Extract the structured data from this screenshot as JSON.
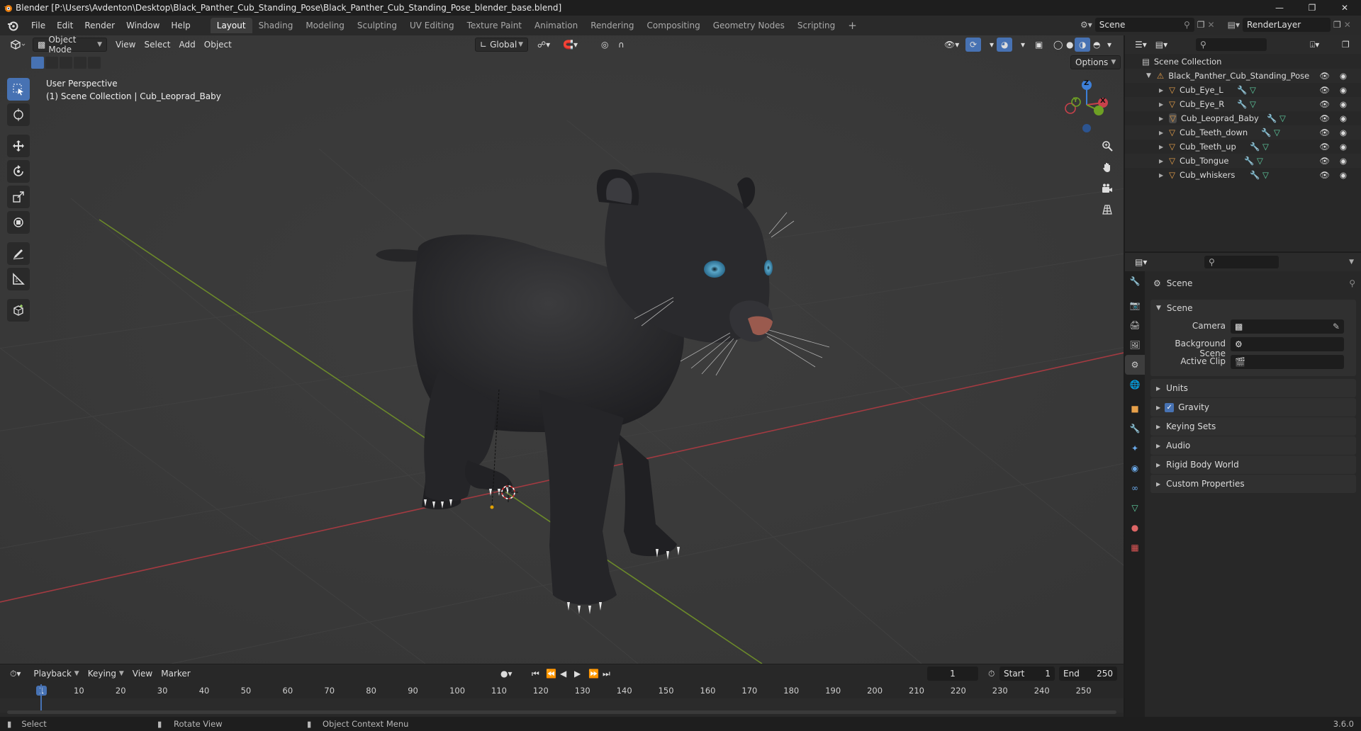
{
  "window": {
    "title": "Blender [P:\\Users\\Avdenton\\Desktop\\Black_Panther_Cub_Standing_Pose\\Black_Panther_Cub_Standing_Pose_blender_base.blend]",
    "controls": [
      "minimize-icon",
      "maximize-icon",
      "close-icon"
    ]
  },
  "menu": {
    "items": [
      "File",
      "Edit",
      "Render",
      "Window",
      "Help"
    ]
  },
  "workspaces": {
    "tabs": [
      "Layout",
      "Shading",
      "Modeling",
      "Sculpting",
      "UV Editing",
      "Texture Paint",
      "Animation",
      "Rendering",
      "Compositing",
      "Geometry Nodes",
      "Scripting"
    ],
    "active": "Layout",
    "add_label": "+"
  },
  "scene_selector": {
    "value": "Scene"
  },
  "view_layer": {
    "value": "RenderLayer"
  },
  "viewport_header": {
    "mode": "Object Mode",
    "menus": [
      "View",
      "Select",
      "Add",
      "Object"
    ],
    "orientation": "Global",
    "options_label": "Options"
  },
  "viewport": {
    "perspective": "User Perspective",
    "context": "(1) Scene Collection | Cub_Leoprad_Baby",
    "gizmo_axes": {
      "x": "X",
      "y": "Y",
      "z": "Z"
    },
    "colors": {
      "x_axis": "#c8414b",
      "y_axis": "#6ea024",
      "z_axis": "#3d7fd8",
      "bg": "#393939"
    }
  },
  "toolbar": {
    "tools": [
      "select-box-icon",
      "cursor-icon",
      "move-icon",
      "rotate-icon",
      "scale-icon",
      "transform-icon",
      "annotate-icon",
      "measure-icon",
      "add-cube-icon"
    ],
    "active": "select-box-icon"
  },
  "outliner": {
    "root": "Scene Collection",
    "collection": "Black_Panther_Cub_Standing_Pose",
    "objects": [
      "Cub_Eye_L",
      "Cub_Eye_R",
      "Cub_Leoprad_Baby",
      "Cub_Teeth_down",
      "Cub_Teeth_up",
      "Cub_Tongue",
      "Cub_whiskers"
    ],
    "selected": "Cub_Leoprad_Baby"
  },
  "properties": {
    "header": "Scene",
    "panel_title": "Scene",
    "fields": [
      {
        "label": "Camera",
        "value": ""
      },
      {
        "label": "Background Scene",
        "value": ""
      },
      {
        "label": "Active Clip",
        "value": ""
      }
    ],
    "subpanels": [
      "Units",
      "Gravity",
      "Keying Sets",
      "Audio",
      "Rigid Body World",
      "Custom Properties"
    ],
    "gravity_checked": true
  },
  "timeline": {
    "menus": [
      "Playback",
      "Keying",
      "View",
      "Marker"
    ],
    "current_frame": "1",
    "start_label": "Start",
    "start": "1",
    "end_label": "End",
    "end": "250",
    "ruler": [
      "1",
      "10",
      "20",
      "30",
      "40",
      "50",
      "60",
      "70",
      "80",
      "90",
      "100",
      "110",
      "120",
      "130",
      "140",
      "150",
      "160",
      "170",
      "180",
      "190",
      "200",
      "210",
      "220",
      "230",
      "240",
      "250"
    ]
  },
  "statusbar": {
    "select": "Select",
    "rotate": "Rotate View",
    "context_menu": "Object Context Menu",
    "version": "3.6.0"
  }
}
